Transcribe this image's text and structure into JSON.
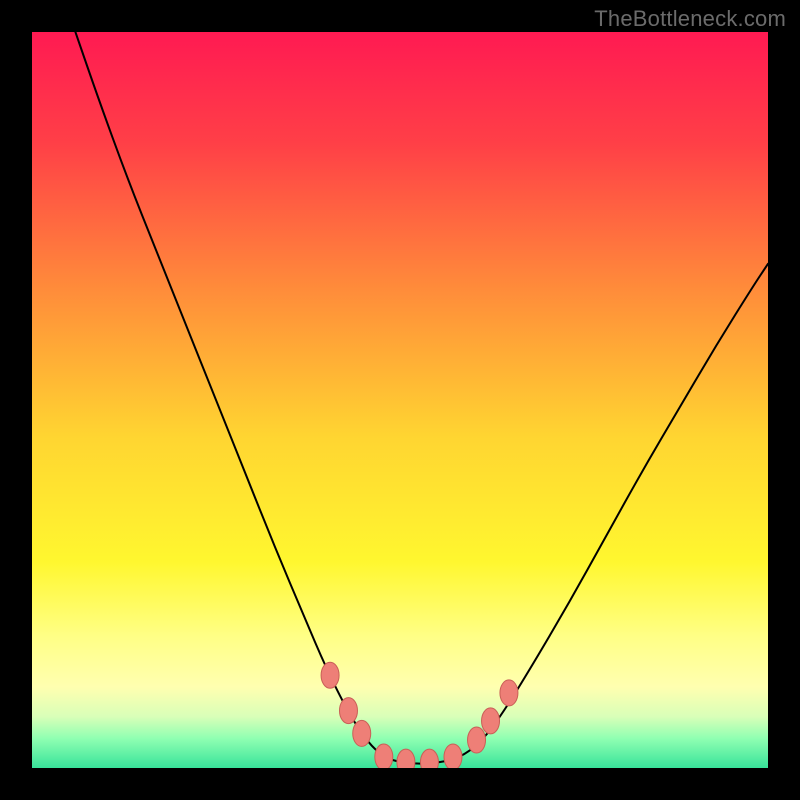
{
  "watermark": "TheBottleneck.com",
  "chart_data": {
    "type": "line",
    "title": "",
    "xlabel": "",
    "ylabel": "",
    "xlim": [
      0,
      1
    ],
    "ylim": [
      0,
      1
    ],
    "background_gradient": {
      "stops": [
        {
          "offset": 0.0,
          "color": "#ff1a52"
        },
        {
          "offset": 0.15,
          "color": "#ff3f47"
        },
        {
          "offset": 0.35,
          "color": "#ff8c3a"
        },
        {
          "offset": 0.55,
          "color": "#ffd531"
        },
        {
          "offset": 0.72,
          "color": "#fff72f"
        },
        {
          "offset": 0.82,
          "color": "#ffff85"
        },
        {
          "offset": 0.89,
          "color": "#ffffb0"
        },
        {
          "offset": 0.93,
          "color": "#d9ffb8"
        },
        {
          "offset": 0.96,
          "color": "#8fffb2"
        },
        {
          "offset": 1.0,
          "color": "#38e39a"
        }
      ]
    },
    "series": [
      {
        "name": "curve",
        "stroke": "#000000",
        "stroke_width": 2,
        "points": [
          {
            "x": 0.059,
            "y": 1.0
          },
          {
            "x": 0.09,
            "y": 0.91
          },
          {
            "x": 0.13,
            "y": 0.8
          },
          {
            "x": 0.17,
            "y": 0.7
          },
          {
            "x": 0.21,
            "y": 0.6
          },
          {
            "x": 0.25,
            "y": 0.5
          },
          {
            "x": 0.29,
            "y": 0.4
          },
          {
            "x": 0.33,
            "y": 0.3
          },
          {
            "x": 0.37,
            "y": 0.205
          },
          {
            "x": 0.4,
            "y": 0.135
          },
          {
            "x": 0.43,
            "y": 0.075
          },
          {
            "x": 0.456,
            "y": 0.035
          },
          {
            "x": 0.48,
            "y": 0.013
          },
          {
            "x": 0.51,
            "y": 0.006
          },
          {
            "x": 0.545,
            "y": 0.006
          },
          {
            "x": 0.58,
            "y": 0.013
          },
          {
            "x": 0.61,
            "y": 0.035
          },
          {
            "x": 0.64,
            "y": 0.075
          },
          {
            "x": 0.68,
            "y": 0.14
          },
          {
            "x": 0.73,
            "y": 0.225
          },
          {
            "x": 0.78,
            "y": 0.315
          },
          {
            "x": 0.83,
            "y": 0.405
          },
          {
            "x": 0.88,
            "y": 0.49
          },
          {
            "x": 0.93,
            "y": 0.575
          },
          {
            "x": 0.98,
            "y": 0.655
          },
          {
            "x": 1.0,
            "y": 0.685
          }
        ]
      }
    ],
    "markers": {
      "fill": "#ee7f77",
      "stroke": "#c95f57",
      "points": [
        {
          "x": 0.405,
          "y": 0.126
        },
        {
          "x": 0.43,
          "y": 0.078
        },
        {
          "x": 0.448,
          "y": 0.047
        },
        {
          "x": 0.478,
          "y": 0.015
        },
        {
          "x": 0.508,
          "y": 0.008
        },
        {
          "x": 0.54,
          "y": 0.008
        },
        {
          "x": 0.572,
          "y": 0.015
        },
        {
          "x": 0.604,
          "y": 0.038
        },
        {
          "x": 0.623,
          "y": 0.064
        },
        {
          "x": 0.648,
          "y": 0.102
        }
      ]
    }
  }
}
